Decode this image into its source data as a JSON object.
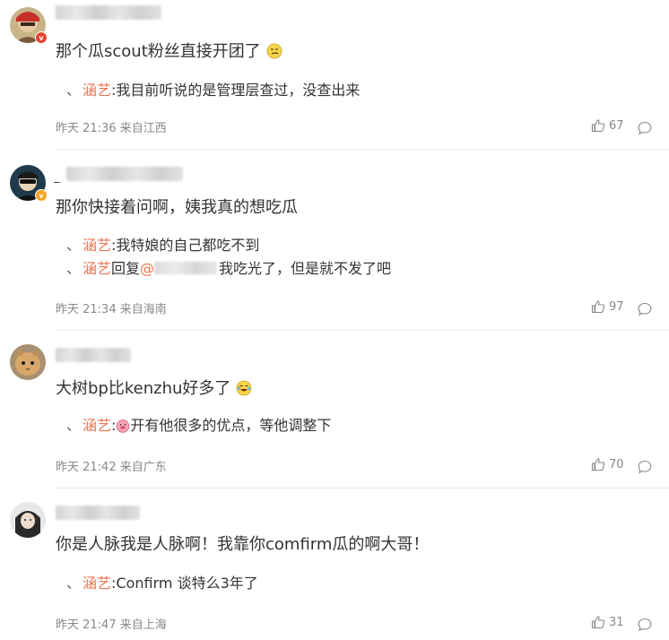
{
  "comments": [
    {
      "username": "",
      "text": "那个瓜scout粉丝直接开团了",
      "emoji": "smug-face-emoji",
      "replies": [
        {
          "name": "涵艺",
          "sep": ":",
          "text": "我目前听说的是管理层查过，没查出来"
        }
      ],
      "time": "昨天 21:36",
      "location": "来自江西",
      "likes": "67",
      "badge_color": "#e8452c"
    },
    {
      "username": "_",
      "text": "那你快接着问啊，姨我真的想吃瓜",
      "replies": [
        {
          "name": "涵艺",
          "sep": ":",
          "text": "我特娘的自己都吃不到"
        },
        {
          "name": "涵艺",
          "sep": "",
          "reply_word": "回复",
          "at": "@",
          "text": "我吃光了，但是就不发了吧"
        }
      ],
      "time": "昨天 21:34",
      "location": "来自海南",
      "likes": "97",
      "badge_color": "#f5a623"
    },
    {
      "username": "",
      "text": "大树bp比kenzhu好多了",
      "emoji": "laughing-tears-emoji",
      "replies": [
        {
          "name": "涵艺",
          "sep": ":",
          "emoji": "pig-emoji",
          "text": "开有他很多的优点，等他调整下"
        }
      ],
      "time": "昨天 21:42",
      "location": "来自广东",
      "likes": "70"
    },
    {
      "username": "",
      "text": "你是人脉我是人脉啊！我靠你comfirm瓜的啊大哥！",
      "replies": [
        {
          "name": "涵艺",
          "sep": ":",
          "text": "Confirm 谈特么3年了"
        }
      ],
      "time": "昨天 21:47",
      "location": "来自上海",
      "likes": "31"
    }
  ],
  "icons": {
    "like": "thumbs-up-icon",
    "comment": "comment-bubble-icon",
    "badge": "v-verified-badge"
  },
  "colors": {
    "reply_name": "#eb7350",
    "meta": "#888888",
    "text": "#333333"
  }
}
